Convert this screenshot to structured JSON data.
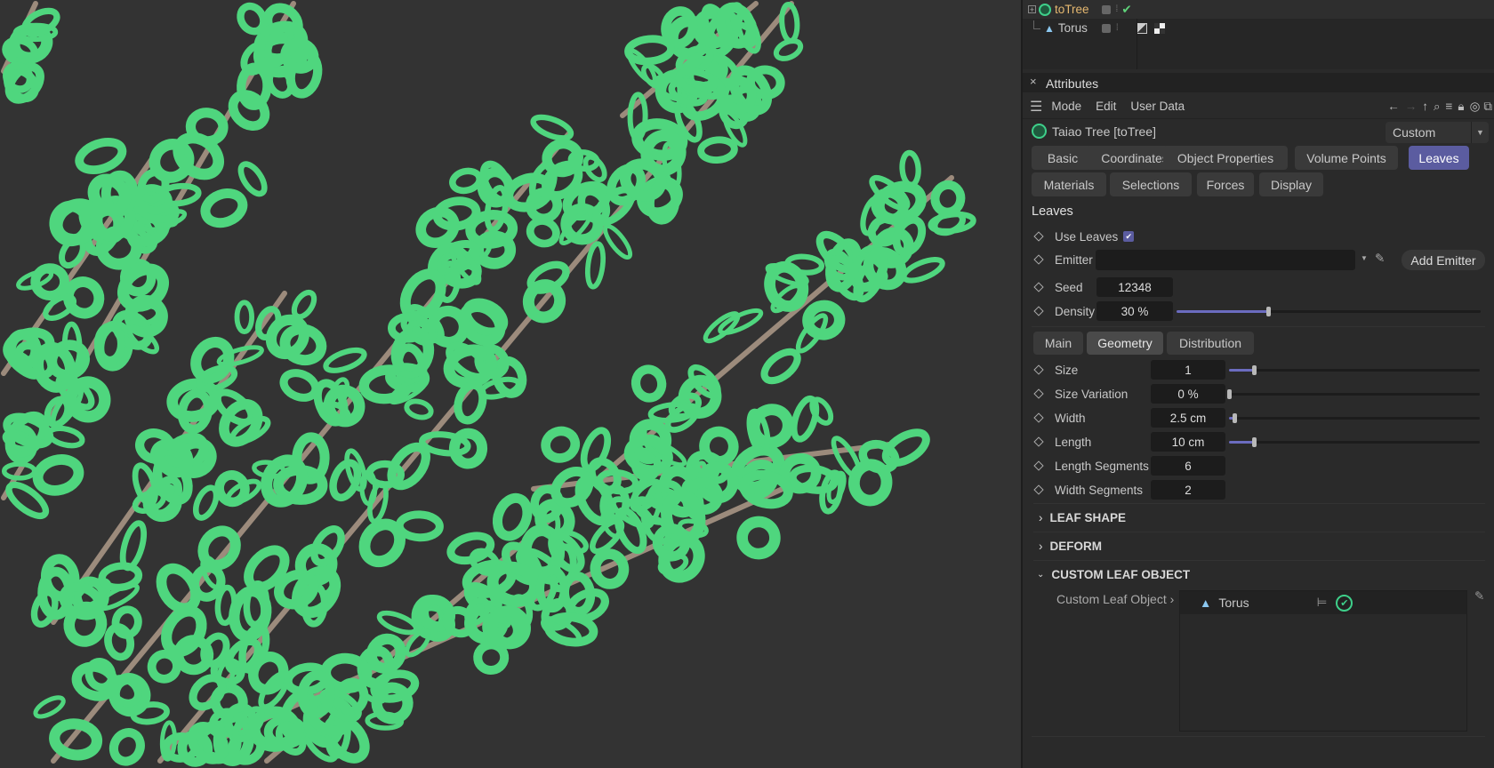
{
  "object_manager": {
    "objects": [
      {
        "name": "toTree",
        "color": "#e5b870"
      },
      {
        "name": "Torus",
        "color": "#c8c8c8"
      }
    ]
  },
  "attributes": {
    "title": "Attributes",
    "menu": [
      "Mode",
      "Edit",
      "User Data"
    ],
    "object_title": "Taiao Tree [toTree]",
    "mode_select": "Custom",
    "tabs": [
      "Basic",
      "Coordinates",
      "Object Properties",
      "Volume Points",
      "Leaves",
      "Materials",
      "Selections",
      "Forces",
      "Display"
    ],
    "active_tab": "Leaves",
    "section_title": "Leaves",
    "use_leaves": {
      "label": "Use Leaves",
      "checked": true
    },
    "emitter": {
      "label": "Emitter",
      "value": "",
      "button": "Add Emitter"
    },
    "seed": {
      "label": "Seed",
      "value": "12348"
    },
    "density": {
      "label": "Density",
      "value": "30 %",
      "slider": 0.3
    },
    "subtabs": [
      "Main",
      "Geometry",
      "Distribution"
    ],
    "active_subtab": "Geometry",
    "geometry": [
      {
        "label": "Size",
        "value": "1",
        "slider": 0.1
      },
      {
        "label": "Size Variation",
        "value": "0 %",
        "slider": 0.0
      },
      {
        "label": "Width",
        "value": "2.5 cm",
        "slider": 0.02
      },
      {
        "label": "Length",
        "value": "10 cm",
        "slider": 0.1
      },
      {
        "label": "Length Segments",
        "value": "6"
      },
      {
        "label": "Width Segments",
        "value": "2"
      }
    ],
    "sections": [
      {
        "label": "LEAF SHAPE",
        "open": false
      },
      {
        "label": "DEFORM",
        "open": false
      },
      {
        "label": "CUSTOM LEAF OBJECT",
        "open": true
      }
    ],
    "custom_leaf": {
      "label": "Custom Leaf Object",
      "item": "Torus"
    }
  },
  "colors": {
    "accent": "#5b5ca0",
    "leaf": "#4fd67e",
    "branch": "#9c8b7c",
    "viewport_bg": "#333333"
  }
}
